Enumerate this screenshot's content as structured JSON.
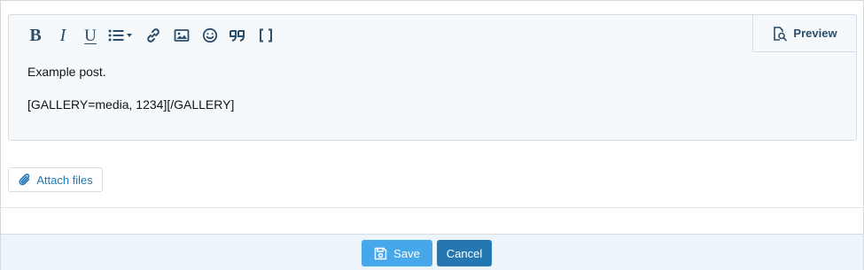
{
  "toolbar": {
    "buttons": [
      {
        "name": "bold-icon",
        "label": "Bold"
      },
      {
        "name": "italic-icon",
        "label": "Italic"
      },
      {
        "name": "underline-icon",
        "label": "Underline"
      },
      {
        "name": "list-icon",
        "label": "List"
      },
      {
        "name": "link-icon",
        "label": "Link"
      },
      {
        "name": "image-icon",
        "label": "Image"
      },
      {
        "name": "smiley-icon",
        "label": "Smilies"
      },
      {
        "name": "quote-icon",
        "label": "Quote"
      },
      {
        "name": "brackets-icon",
        "label": "Toggle BB code"
      }
    ],
    "preview_label": "Preview"
  },
  "editor": {
    "lines": [
      "Example post.",
      "[GALLERY=media, 1234][/GALLERY]"
    ]
  },
  "attach": {
    "label": "Attach files"
  },
  "footer": {
    "save_label": "Save",
    "cancel_label": "Cancel"
  },
  "colors": {
    "accent": "#2577b1",
    "save_bg": "#47a7eb",
    "icon": "#2a4d6b",
    "editor_bg": "#f5f9fc",
    "footer_bg": "#edf4fa"
  }
}
